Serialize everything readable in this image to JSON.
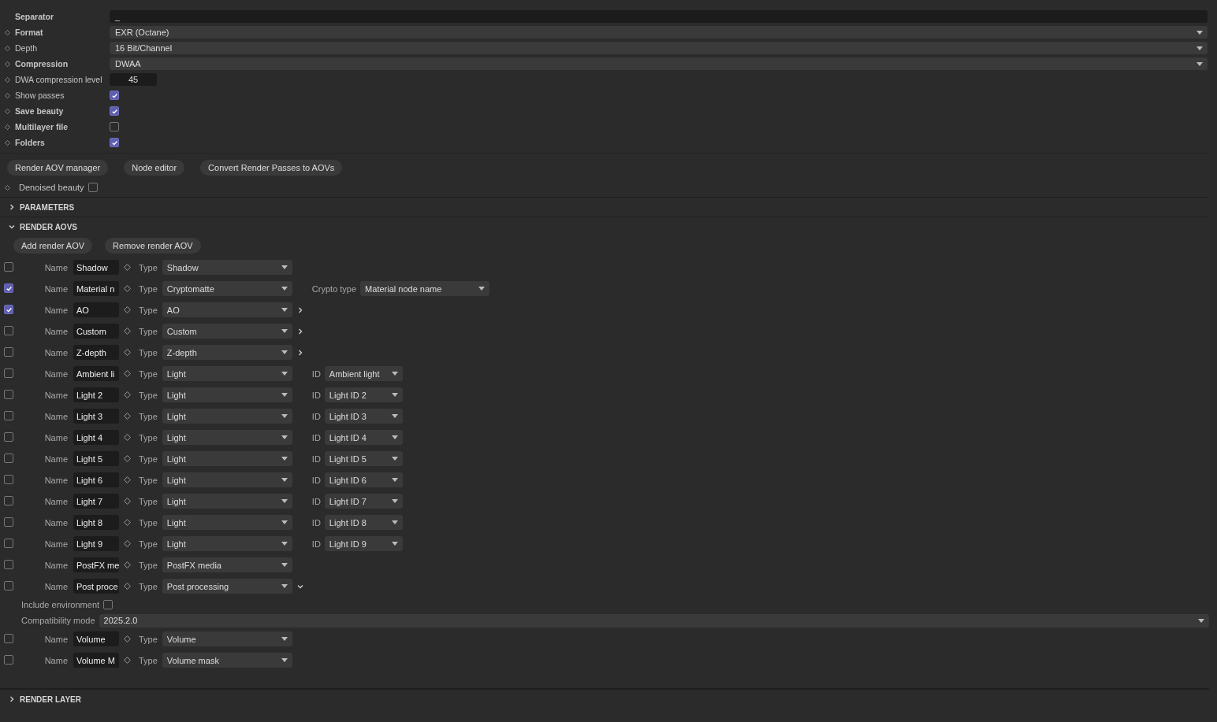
{
  "settings": [
    {
      "label": "Separator",
      "bold": true,
      "animatable": false,
      "kind": "text",
      "value": "_"
    },
    {
      "label": "Format",
      "bold": true,
      "animatable": true,
      "kind": "dropdown",
      "value": "EXR (Octane)"
    },
    {
      "label": "Depth",
      "bold": false,
      "animatable": true,
      "kind": "dropdown",
      "value": "16 Bit/Channel"
    },
    {
      "label": "Compression",
      "bold": true,
      "animatable": true,
      "kind": "dropdown",
      "value": "DWAA"
    },
    {
      "label": "DWA compression level",
      "bold": false,
      "animatable": true,
      "kind": "number",
      "value": "45"
    },
    {
      "label": "Show passes",
      "bold": false,
      "animatable": true,
      "kind": "checkbox",
      "checked": true
    },
    {
      "label": "Save beauty",
      "bold": true,
      "animatable": true,
      "kind": "checkbox",
      "checked": true
    },
    {
      "label": "Multilayer file",
      "bold": true,
      "animatable": true,
      "kind": "checkbox",
      "checked": false
    },
    {
      "label": "Folders",
      "bold": true,
      "animatable": true,
      "kind": "checkbox",
      "checked": true
    }
  ],
  "buttons": [
    "Render AOV manager",
    "Node editor",
    "Convert Render Passes to AOVs"
  ],
  "denoised_beauty": {
    "label": "Denoised beauty",
    "checked": false
  },
  "parameters": {
    "title": "PARAMETERS",
    "expanded": false
  },
  "render_aovs": {
    "title": "RENDER AOVS",
    "expanded": true,
    "buttons": [
      "Add render AOV",
      "Remove render AOV"
    ],
    "aovs": [
      {
        "checked": false,
        "name_label": "Name",
        "name": "Shadow",
        "type_label": "Type",
        "type": "Shadow"
      },
      {
        "checked": true,
        "name_label": "Name",
        "name": "Material n",
        "type_label": "Type",
        "type": "Cryptomatte",
        "extra_label": "Crypto type",
        "extra_value": "Material node name",
        "kind": "crypto"
      },
      {
        "checked": true,
        "name_label": "Name",
        "name": "AO",
        "type_label": "Type",
        "type": "AO",
        "expanded": false
      },
      {
        "checked": false,
        "name_label": "Name",
        "name": "Custom",
        "type_label": "Type",
        "type": "Custom",
        "expanded": false
      },
      {
        "checked": false,
        "name_label": "Name",
        "name": "Z-depth",
        "type_label": "Type",
        "type": "Z-depth",
        "expanded": false
      },
      {
        "checked": false,
        "name_label": "Name",
        "name": "Ambient li",
        "type_label": "Type",
        "type": "Light",
        "extra_label": "ID",
        "extra_value": "Ambient light",
        "kind": "light"
      },
      {
        "checked": false,
        "name_label": "Name",
        "name": "Light 2",
        "type_label": "Type",
        "type": "Light",
        "extra_label": "ID",
        "extra_value": "Light ID 2",
        "kind": "light"
      },
      {
        "checked": false,
        "name_label": "Name",
        "name": "Light 3",
        "type_label": "Type",
        "type": "Light",
        "extra_label": "ID",
        "extra_value": "Light ID 3",
        "kind": "light"
      },
      {
        "checked": false,
        "name_label": "Name",
        "name": "Light 4",
        "type_label": "Type",
        "type": "Light",
        "extra_label": "ID",
        "extra_value": "Light ID 4",
        "kind": "light"
      },
      {
        "checked": false,
        "name_label": "Name",
        "name": "Light 5",
        "type_label": "Type",
        "type": "Light",
        "extra_label": "ID",
        "extra_value": "Light ID 5",
        "kind": "light"
      },
      {
        "checked": false,
        "name_label": "Name",
        "name": "Light 6",
        "type_label": "Type",
        "type": "Light",
        "extra_label": "ID",
        "extra_value": "Light ID 6",
        "kind": "light"
      },
      {
        "checked": false,
        "name_label": "Name",
        "name": "Light 7",
        "type_label": "Type",
        "type": "Light",
        "extra_label": "ID",
        "extra_value": "Light ID 7",
        "kind": "light"
      },
      {
        "checked": false,
        "name_label": "Name",
        "name": "Light 8",
        "type_label": "Type",
        "type": "Light",
        "extra_label": "ID",
        "extra_value": "Light ID 8",
        "kind": "light"
      },
      {
        "checked": false,
        "name_label": "Name",
        "name": "Light 9",
        "type_label": "Type",
        "type": "Light",
        "extra_label": "ID",
        "extra_value": "Light ID 9",
        "kind": "light"
      },
      {
        "checked": false,
        "name_label": "Name",
        "name": "PostFX me",
        "type_label": "Type",
        "type": "PostFX media"
      },
      {
        "checked": false,
        "name_label": "Name",
        "name": "Post proce",
        "type_label": "Type",
        "type": "Post processing",
        "expanded": true,
        "include_environment": {
          "label": "Include environment",
          "checked": false
        },
        "compatibility_mode": {
          "label": "Compatibility mode",
          "value": "2025.2.0"
        }
      },
      {
        "checked": false,
        "name_label": "Name",
        "name": "Volume",
        "type_label": "Type",
        "type": "Volume"
      },
      {
        "checked": false,
        "name_label": "Name",
        "name": "Volume M",
        "type_label": "Type",
        "type": "Volume mask"
      }
    ]
  },
  "render_layer": {
    "title": "RENDER LAYER",
    "expanded": false
  }
}
